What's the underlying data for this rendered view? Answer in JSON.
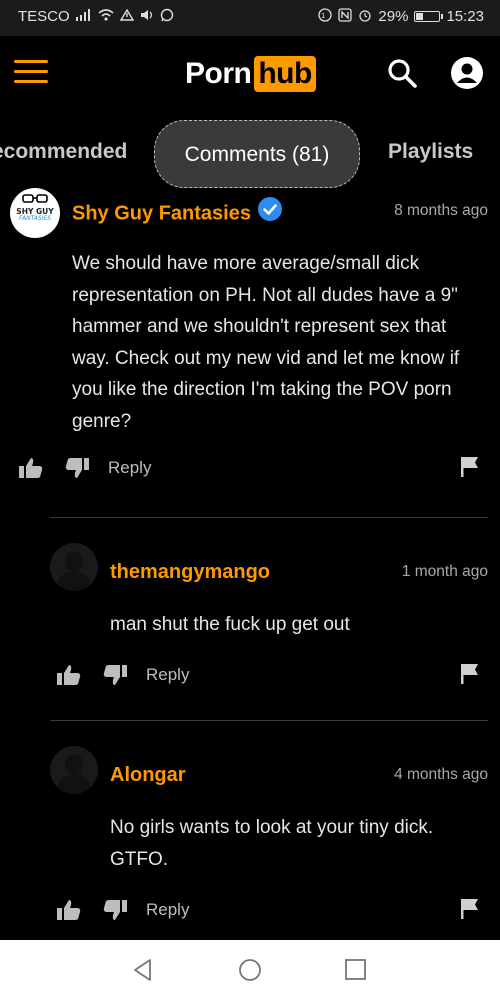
{
  "status_bar": {
    "carrier": "TESCO",
    "battery": "29%",
    "battery_level": 0.29,
    "time": "15:23"
  },
  "header": {
    "logo_left": "Porn",
    "logo_right": "hub",
    "accent": "#ff9900"
  },
  "tabs": {
    "recommended": "ecommended",
    "comments": "Comments (81)",
    "playlists": "Playlists"
  },
  "comments": [
    {
      "user": "Shy Guy Fantasies",
      "verified": true,
      "time": "8 months ago",
      "text": "We should have more average/small dick representation on PH. Not all dudes have a 9\" hammer and we shouldn't represent sex that way. Check out my new vid and let me know if you like the direction I'm taking the POV porn genre?",
      "avatar_text_top": "SHY GUY",
      "avatar_text_bottom": "FANTASIES",
      "reply": "Reply"
    },
    {
      "user": "themangymango",
      "time": "1 month ago",
      "text": "man shut the fuck up get out",
      "reply": "Reply"
    },
    {
      "user": "Alongar",
      "time": "4 months ago",
      "text": "No girls wants to look at your tiny dick. GTFO.",
      "reply": "Reply"
    }
  ]
}
